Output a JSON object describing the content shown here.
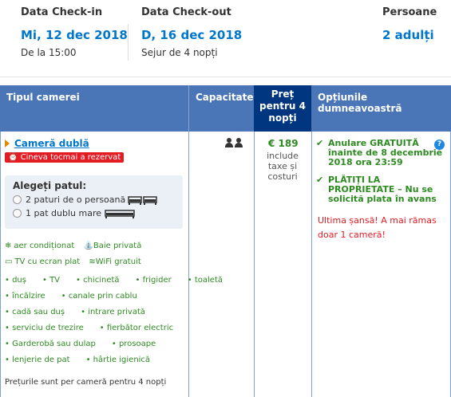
{
  "stay": {
    "checkin_label": "Data Check-in",
    "checkin_date": "Mi, 12 dec 2018",
    "checkin_time": "De la 15:00",
    "checkout_label": "Data Check-out",
    "checkout_date": "D, 16 dec 2018",
    "stay_length": "Sejur de 4 nopți",
    "guests_label": "Persoane",
    "guests_value": "2 adulți"
  },
  "table_header": {
    "room_type": "Tipul camerei",
    "capacity": "Capacitate",
    "price_line1": "Preț",
    "price_line2": "pentru 4",
    "price_line3": "nopți",
    "options": "Opțiunile dumneavoastră"
  },
  "room": {
    "name": "Cameră dublă",
    "booked_badge": "Cineva tocmai a rezervat",
    "bed_title": "Alegeți patul:",
    "bed_options": [
      "2 paturi de o persoană",
      "1 pat dublu mare"
    ],
    "amenities_icons": [
      "aer condiționat",
      "Baie privată",
      "TV cu ecran plat",
      "WiFi gratuit"
    ],
    "amenities": [
      [
        "duș",
        "TV",
        "chicinetă",
        "frigider",
        "toaletă"
      ],
      [
        "încălzire",
        "canale prin cablu"
      ],
      [
        "cadă sau duș",
        "intrare privată"
      ],
      [
        "serviciu de trezire",
        "fierbător electric"
      ],
      [
        "Garderobă sau dulap",
        "prosoape"
      ],
      [
        "lenjerie de pat",
        "hârtie igienică"
      ]
    ],
    "price_note": "Prețurile sunt per cameră pentru 4 nopți"
  },
  "price": {
    "value": "€ 189",
    "note1": "include",
    "note2": "taxe și",
    "note3": "costuri"
  },
  "options": {
    "cancel_line1": "Anulare GRATUITĂ",
    "cancel_line2": "înainte de 8 decembrie",
    "cancel_line3": "2018 ora 23:59",
    "pay_line1": "PLĂTIȚI LA",
    "pay_line2": "PROPRIETATE – Nu se",
    "pay_line3": "solicită plata în avans",
    "last_chance_line1": "Ultima șansă! A mai rămas",
    "last_chance_line2": "doar 1 cameră!"
  },
  "colors": {
    "link_blue": "#0077cc",
    "header_blue": "#4a76b8",
    "price_header": "#003580",
    "green": "#2e8b22",
    "red": "#e31b23"
  }
}
